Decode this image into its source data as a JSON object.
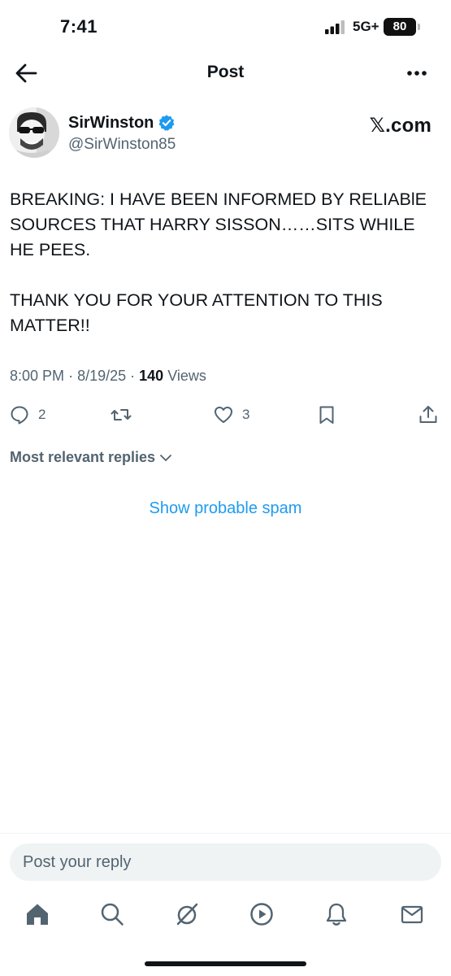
{
  "status_bar": {
    "time": "7:41",
    "network": "5G+",
    "battery": "80"
  },
  "header": {
    "title": "Post"
  },
  "post": {
    "author_name": "SirWinston",
    "author_handle": "@SirWinston85",
    "source_label": "𝕏.com",
    "text_paragraphs": [
      "BREAKING: I HAVE BEEN INFORMED BY RELIABlE SOURCES THAT HARRY SISSON……SITS WHILE HE PEES.",
      "THANK YOU FOR YOUR ATTENTION TO THIS MATTER!!"
    ],
    "time": "8:00 PM",
    "date": "8/19/25",
    "views_count": "140",
    "views_label": "Views",
    "replies_count": "2",
    "likes_count": "3"
  },
  "replies": {
    "sort_label": "Most relevant replies",
    "show_spam_label": "Show probable spam"
  },
  "reply_box": {
    "placeholder": "Post your reply"
  },
  "icons": {
    "back": "arrow-left-icon",
    "more": "more-horizontal-icon",
    "verified": "verified-badge-icon",
    "reply": "comment-icon",
    "repost": "repost-icon",
    "like": "heart-icon",
    "bookmark": "bookmark-icon",
    "share": "share-icon",
    "home": "home-icon",
    "search": "search-icon",
    "grok": "grok-icon",
    "video": "play-icon",
    "notifications": "bell-icon",
    "messages": "mail-icon"
  },
  "colors": {
    "accent": "#1d9bf0",
    "text_primary": "#0f1419",
    "text_secondary": "#536471"
  }
}
